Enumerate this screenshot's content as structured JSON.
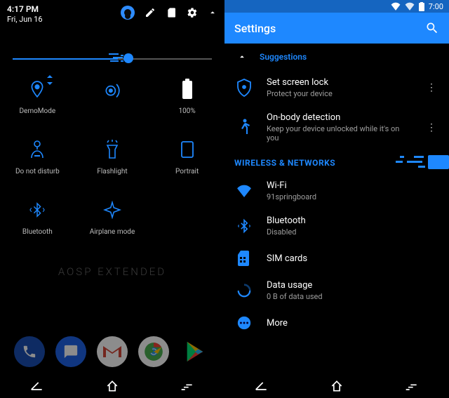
{
  "left": {
    "time": "4:17 PM",
    "date": "Fri, Jun 16",
    "tiles": [
      {
        "label": "DemoMode"
      },
      {
        "label": ""
      },
      {
        "label": "100%"
      },
      {
        "label": "Do not disturb"
      },
      {
        "label": "Flashlight"
      },
      {
        "label": "Portrait"
      },
      {
        "label": "Bluetooth"
      },
      {
        "label": "Airplane mode"
      }
    ],
    "wallpaper_text": "AOSP EXTENDED"
  },
  "right": {
    "clock": "7:00",
    "title": "Settings",
    "suggestions_label": "Suggestions",
    "suggestions": [
      {
        "primary": "Set screen lock",
        "secondary": "Protect your device"
      },
      {
        "primary": "On-body detection",
        "secondary": "Keep your device unlocked while it's on you"
      }
    ],
    "section_wireless": "WIRELESS & NETWORKS",
    "items": [
      {
        "primary": "Wi-Fi",
        "secondary": "91springboard"
      },
      {
        "primary": "Bluetooth",
        "secondary": "Disabled"
      },
      {
        "primary": "SIM cards",
        "secondary": ""
      },
      {
        "primary": "Data usage",
        "secondary": "0 B of data used"
      },
      {
        "primary": "More",
        "secondary": ""
      }
    ]
  }
}
